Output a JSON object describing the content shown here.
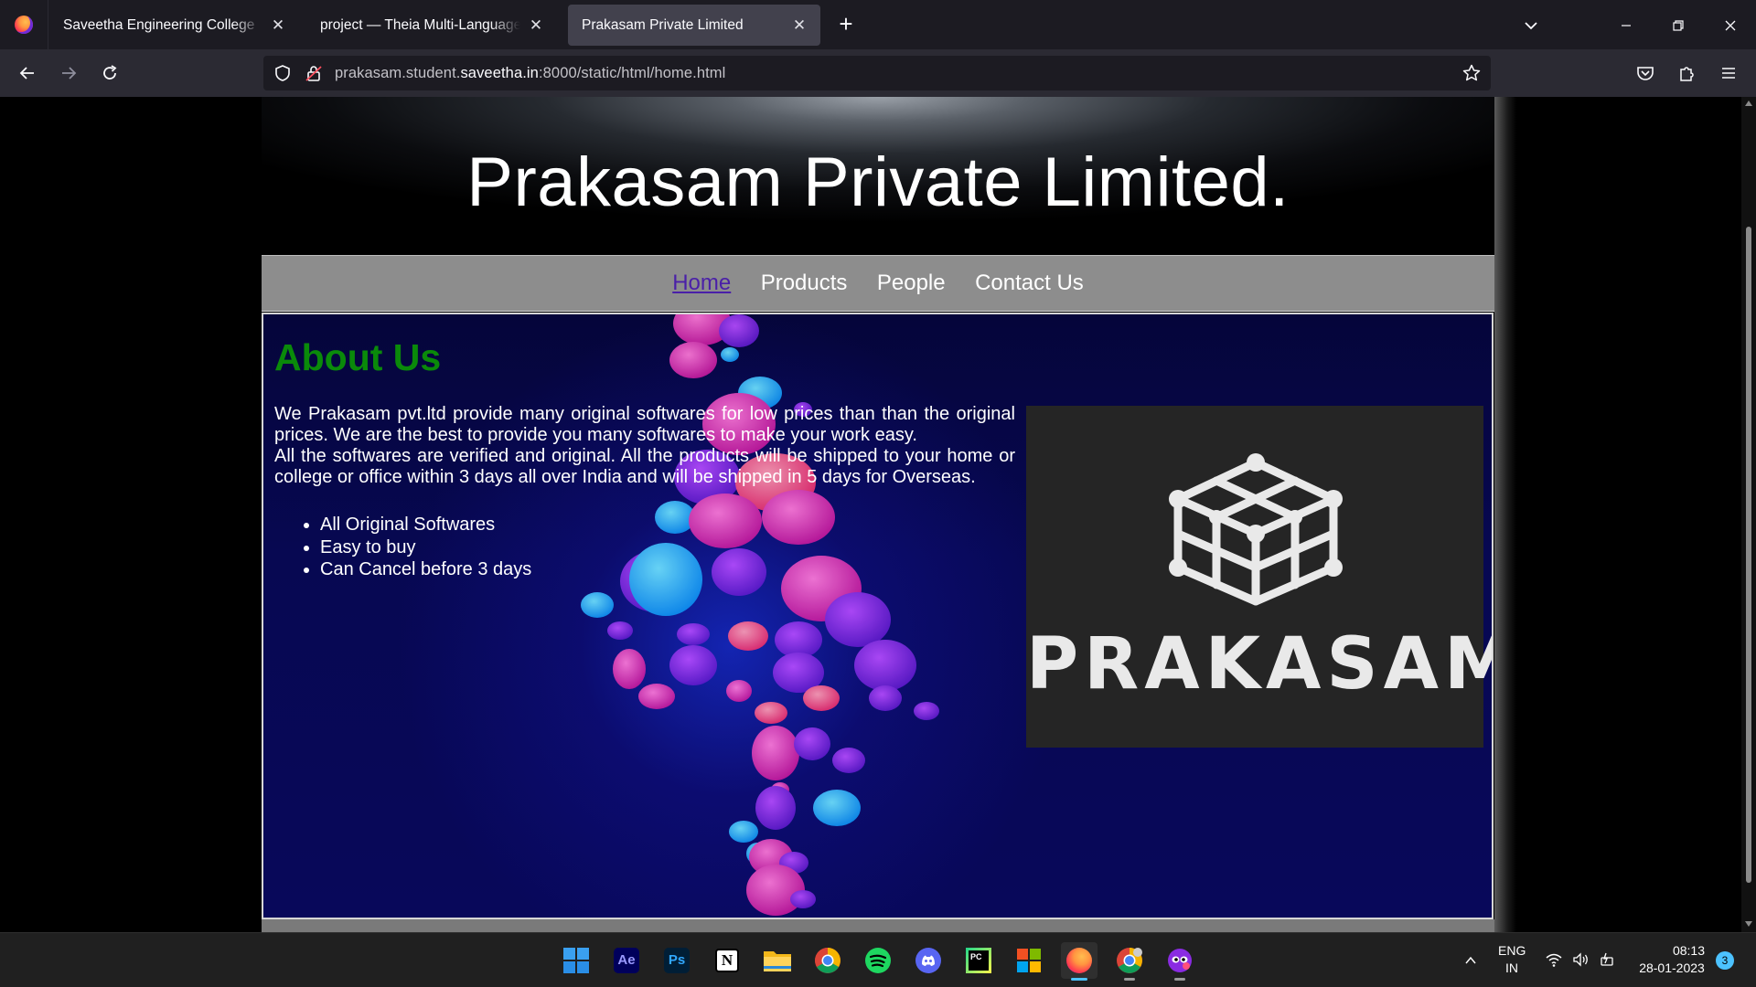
{
  "browser": {
    "tabs": [
      {
        "title": "Saveetha Engineering College",
        "active": false
      },
      {
        "title": "project — Theia Multi-Language Ex",
        "active": false
      },
      {
        "title": "Prakasam Private Limited",
        "active": true
      }
    ],
    "url": {
      "prefix": "prakasam.student.",
      "domain": "saveetha.in",
      "suffix": ":8000/static/html/home.html"
    }
  },
  "site": {
    "title": "Prakasam Private Limited.",
    "nav": [
      {
        "label": "Home",
        "current": true
      },
      {
        "label": "Products",
        "current": false
      },
      {
        "label": "People",
        "current": false
      },
      {
        "label": "Contact Us",
        "current": false
      }
    ],
    "about": {
      "heading": "About Us",
      "paragraph1": "We Prakasam pvt.ltd provide many original softwares for low prices than than the original prices. We are the best to provide you many softwares to make your work easy.",
      "paragraph2": "All the softwares are verified and original. All the products will be shipped to your home or college or office within 3 days all over India and will be shipped in 5 days for Overseas.",
      "features": [
        "All Original Softwares",
        "Easy to buy",
        "Can Cancel before 3 days"
      ]
    },
    "logo": {
      "word": "PRAKASAM",
      "icon": "cube-network-icon"
    }
  },
  "taskbar": {
    "apps": [
      {
        "name": "windows-start-icon"
      },
      {
        "name": "after-effects-icon",
        "text": "Ae"
      },
      {
        "name": "photoshop-icon",
        "text": "Ps"
      },
      {
        "name": "notion-icon",
        "text": "N"
      },
      {
        "name": "file-explorer-icon"
      },
      {
        "name": "chrome-icon"
      },
      {
        "name": "spotify-icon"
      },
      {
        "name": "discord-icon"
      },
      {
        "name": "pycharm-icon",
        "text": "PC"
      },
      {
        "name": "app-grid-icon"
      },
      {
        "name": "firefox-icon"
      },
      {
        "name": "chrome-profile-icon"
      },
      {
        "name": "mask-app-icon"
      }
    ],
    "language": {
      "line1": "ENG",
      "line2": "IN"
    },
    "time": "08:13",
    "date": "28-01-2023",
    "notifications": "3"
  },
  "colors": {
    "about_heading": "#0a8a0a",
    "nav_bg": "#8d8d8d",
    "nav_current": "#4a1fa8",
    "content_bg": "#07084f"
  }
}
